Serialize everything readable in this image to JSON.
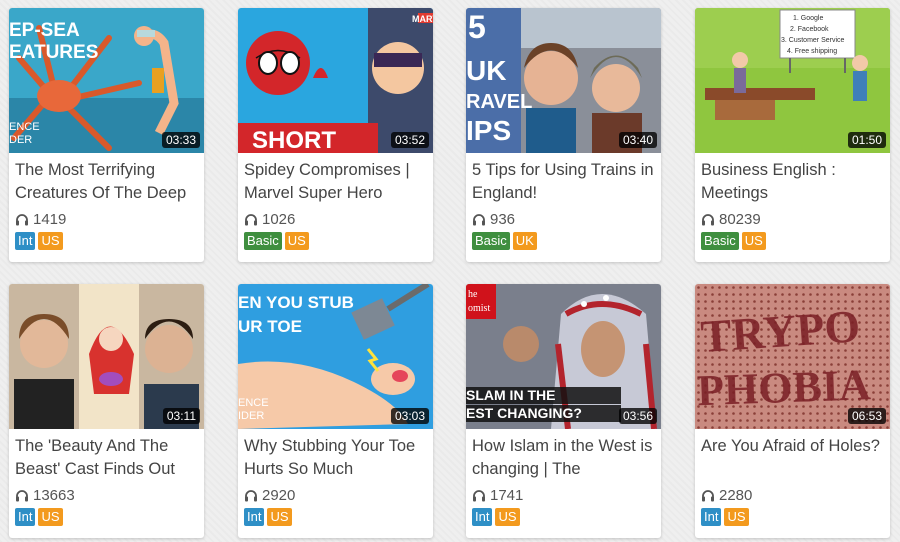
{
  "colors": {
    "level_int": "#2e8fc6",
    "level_basic": "#3f8f3f",
    "region": "#f39a1e"
  },
  "videos": [
    {
      "title": "The Most Terrifying Creatures Of The Deep",
      "duration": "03:33",
      "plays": "1419",
      "level": "Int",
      "region": "US",
      "thumb_text": [
        "EP-SEA",
        "EATURES",
        "ENCE",
        "DER"
      ]
    },
    {
      "title": "Spidey Compromises | Marvel Super Hero",
      "duration": "03:52",
      "plays": "1026",
      "level": "Basic",
      "region": "US",
      "thumb_text": [
        "SHORT",
        "MARV"
      ]
    },
    {
      "title": "5 Tips for Using Trains in England!",
      "duration": "03:40",
      "plays": "936",
      "level": "Basic",
      "region": "UK",
      "thumb_text": [
        "5",
        "UK",
        "RAVEL",
        "IPS"
      ]
    },
    {
      "title": "Business English : Meetings",
      "duration": "01:50",
      "plays": "80239",
      "level": "Basic",
      "region": "US",
      "thumb_text": [
        "1. Google",
        "2. Facebook",
        "3. Customer Service",
        "4. Free shipping"
      ]
    },
    {
      "title": "The 'Beauty And The Beast' Cast Finds Out",
      "duration": "03:11",
      "plays": "13663",
      "level": "Int",
      "region": "US",
      "thumb_text": []
    },
    {
      "title": "Why Stubbing Your Toe Hurts So Much",
      "duration": "03:03",
      "plays": "2920",
      "level": "Int",
      "region": "US",
      "thumb_text": [
        "EN YOU STUB",
        "UR TOE",
        "ENCE",
        "IDER"
      ]
    },
    {
      "title": "How Islam in the West is changing | The",
      "duration": "03:56",
      "plays": "1741",
      "level": "Int",
      "region": "US",
      "thumb_text": [
        "he",
        "omist",
        "SLAM IN THE",
        "EST CHANGING?"
      ]
    },
    {
      "title": "Are You Afraid of Holes?",
      "duration": "06:53",
      "plays": "2280",
      "level": "Int",
      "region": "US",
      "thumb_text": [
        "TRYPO",
        "PHOBIA"
      ]
    }
  ]
}
